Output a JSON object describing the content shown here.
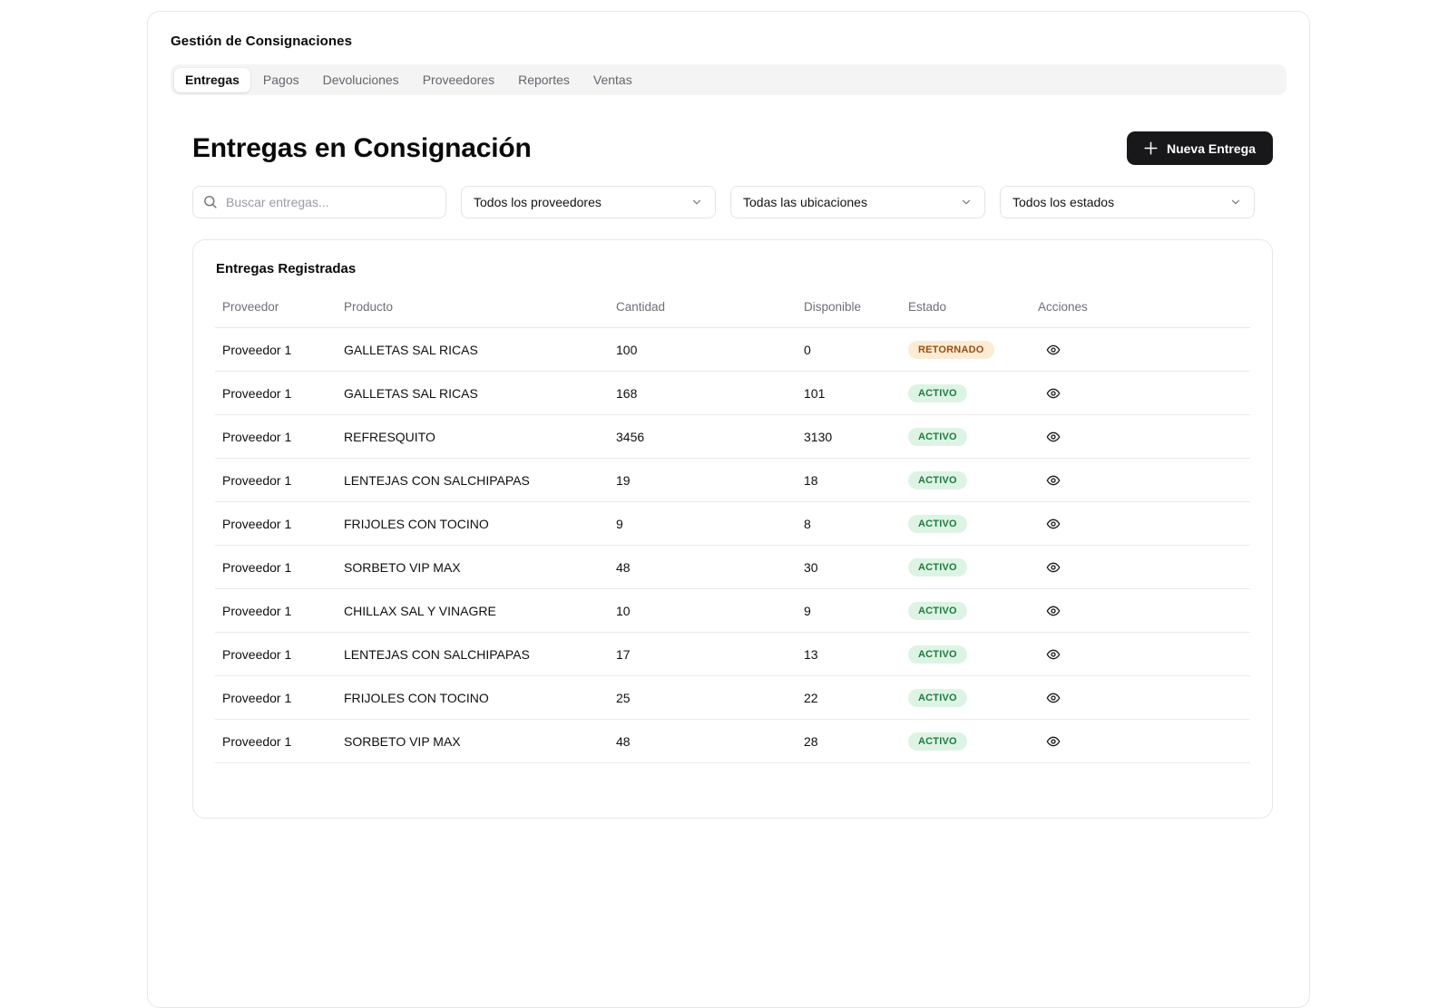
{
  "app": {
    "title": "Gestión de Consignaciones"
  },
  "tabs": [
    {
      "label": "Entregas",
      "active": true
    },
    {
      "label": "Pagos",
      "active": false
    },
    {
      "label": "Devoluciones",
      "active": false
    },
    {
      "label": "Proveedores",
      "active": false
    },
    {
      "label": "Reportes",
      "active": false
    },
    {
      "label": "Ventas",
      "active": false
    }
  ],
  "page": {
    "title": "Entregas en Consignación",
    "new_button_label": "Nueva Entrega",
    "new_button_icon": "plus-icon"
  },
  "filters": {
    "search_placeholder": "Buscar entregas...",
    "search_icon": "magnifier",
    "provider_value": "Todos los proveedores",
    "location_value": "Todas las ubicaciones",
    "status_value": "Todos los estados",
    "dropdown_icon": "chevron-down"
  },
  "table": {
    "title": "Entregas Registradas",
    "columns": [
      "Proveedor",
      "Producto",
      "Cantidad",
      "Disponible",
      "Estado",
      "Acciones"
    ],
    "action_icon": "eye",
    "rows": [
      {
        "proveedor": "Proveedor 1",
        "producto": "GALLETAS SAL RICAS",
        "cantidad": "100",
        "disponible": "0",
        "estado": "RETORNADO"
      },
      {
        "proveedor": "Proveedor 1",
        "producto": "GALLETAS SAL RICAS",
        "cantidad": "168",
        "disponible": "101",
        "estado": "ACTIVO"
      },
      {
        "proveedor": "Proveedor 1",
        "producto": "REFRESQUITO",
        "cantidad": "3456",
        "disponible": "3130",
        "estado": "ACTIVO"
      },
      {
        "proveedor": "Proveedor 1",
        "producto": "LENTEJAS CON SALCHIPAPAS",
        "cantidad": "19",
        "disponible": "18",
        "estado": "ACTIVO"
      },
      {
        "proveedor": "Proveedor 1",
        "producto": "FRIJOLES CON TOCINO",
        "cantidad": "9",
        "disponible": "8",
        "estado": "ACTIVO"
      },
      {
        "proveedor": "Proveedor 1",
        "producto": "SORBETO VIP MAX",
        "cantidad": "48",
        "disponible": "30",
        "estado": "ACTIVO"
      },
      {
        "proveedor": "Proveedor 1",
        "producto": "CHILLAX SAL Y VINAGRE",
        "cantidad": "10",
        "disponible": "9",
        "estado": "ACTIVO"
      },
      {
        "proveedor": "Proveedor 1",
        "producto": "LENTEJAS CON SALCHIPAPAS",
        "cantidad": "17",
        "disponible": "13",
        "estado": "ACTIVO"
      },
      {
        "proveedor": "Proveedor 1",
        "producto": "FRIJOLES CON TOCINO",
        "cantidad": "25",
        "disponible": "22",
        "estado": "ACTIVO"
      },
      {
        "proveedor": "Proveedor 1",
        "producto": "SORBETO VIP MAX",
        "cantidad": "48",
        "disponible": "28",
        "estado": "ACTIVO"
      }
    ]
  },
  "colors": {
    "badge_active_bg": "#ddf4e4",
    "badge_active_text": "#1f7a3f",
    "badge_returned_bg": "#fcecd4",
    "badge_returned_text": "#9a4e12",
    "button_bg": "#18181b",
    "tabbar_bg": "#f4f4f5",
    "border": "#e5e7eb"
  }
}
